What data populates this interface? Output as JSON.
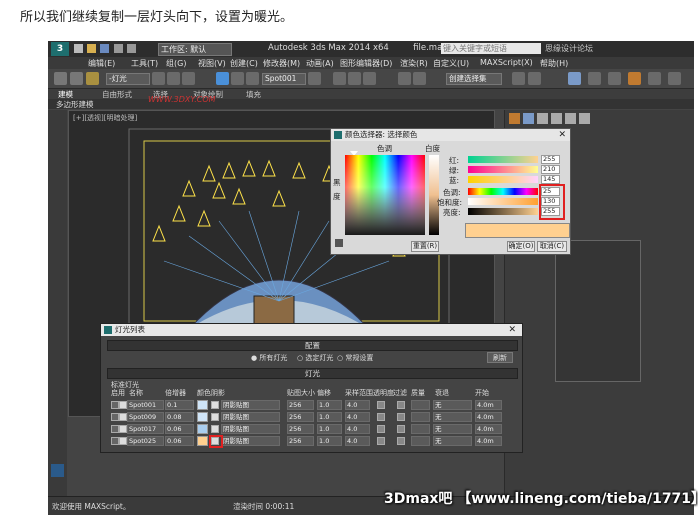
{
  "caption": "所以我们继续复制一层灯头向下，设置为暖光。",
  "titlebar": {
    "workspace": "工作区: 默认",
    "title": "Autodesk 3ds Max 2014 x64",
    "file": "file.max",
    "search_placeholder": "键入关键字或短语",
    "right_text": "思缘设计论坛"
  },
  "menu": [
    "编辑(E)",
    "工具(T)",
    "组(G)",
    "视图(V)",
    "创建(C)",
    "修改器(M)",
    "动画(A)",
    "图形编辑器(D)",
    "渲染(R)",
    "自定义(U)",
    "MAXScript(X)",
    "帮助(H)"
  ],
  "toolbar": {
    "filter_dropdown": "-灯光",
    "selection_dropdown": "Spot001",
    "view_dropdown": "视图",
    "named_set": "创建选择集"
  },
  "ribbon": [
    "建模",
    "自由形式",
    "选择",
    "对象绘制",
    "填充"
  ],
  "subribbon": "多边形建模",
  "viewport_label": "[+][透视][明暗处理]",
  "watermark_top": "WWW.3DXY.COM",
  "color_picker": {
    "title": "颜色选择器: 选择颜色",
    "hue_label": "色调",
    "white_label": "白度",
    "black_label": "黑",
    "degree_label": "度",
    "rows": [
      {
        "label": "红:",
        "value": "255"
      },
      {
        "label": "绿:",
        "value": "210"
      },
      {
        "label": "蓝:",
        "value": "145"
      },
      {
        "label": "色调:",
        "value": "25"
      },
      {
        "label": "饱和度:",
        "value": "130"
      },
      {
        "label": "亮度:",
        "value": "255"
      }
    ],
    "reset_button": "重置(R)",
    "ok_button": "确定(O)",
    "cancel_button": "取消(C)",
    "swatch_color": "#ffd090"
  },
  "light_lister": {
    "title": "灯光列表",
    "config_section": "配置",
    "options": [
      "所有灯光",
      "选定灯光",
      "常规设置"
    ],
    "refresh_button": "刷新",
    "lights_section": "灯光",
    "group_label": "标准灯光",
    "headers": [
      "启用",
      "名称",
      "倍增器",
      "颜色",
      "阴影",
      "贴图大小",
      "偏移",
      "采样范围",
      "透明度",
      "过滤",
      "质量",
      "衰退",
      "开始"
    ],
    "rows": [
      {
        "name": "Spot001",
        "multiplier": "0.1",
        "color": "#cfe4f7",
        "shadow": "阴影贴图",
        "map_size": "256",
        "bias": "1.0",
        "sample": "4.0",
        "decay": "无",
        "start": "4.0m"
      },
      {
        "name": "Spot009",
        "multiplier": "0.08",
        "color": "#cfe4f7",
        "shadow": "阴影贴图",
        "map_size": "256",
        "bias": "1.0",
        "sample": "4.0",
        "decay": "无",
        "start": "4.0m"
      },
      {
        "name": "Spot017",
        "multiplier": "0.06",
        "color": "#a9cdee",
        "shadow": "阴影贴图",
        "map_size": "256",
        "bias": "1.0",
        "sample": "4.0",
        "decay": "无",
        "start": "4.0m"
      },
      {
        "name": "Spot025",
        "multiplier": "0.06",
        "color": "#ffd090",
        "shadow": "阴影贴图",
        "map_size": "256",
        "bias": "1.0",
        "sample": "4.0",
        "decay": "无",
        "start": "4.0m"
      }
    ]
  },
  "status": {
    "welcome": "欢迎使用 MAXScript。",
    "render_time": "渲染时间 0:00:11"
  },
  "watermark_bottom": "3Dmax吧 【www.lineng.com/tieba/1771】"
}
